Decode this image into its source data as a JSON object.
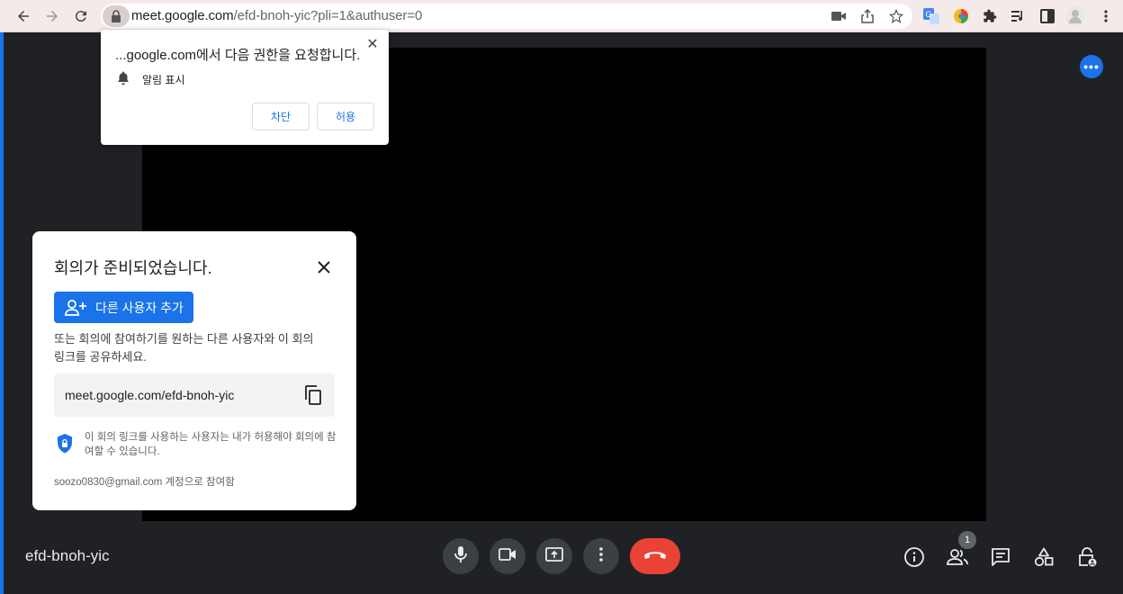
{
  "browser": {
    "url_host": "meet.google.com",
    "url_path": "/efd-bnoh-yic?pli=1&authuser=0"
  },
  "permission_popup": {
    "title": "...google.com에서 다음 권한을 요청합니다.",
    "item": "알림 표시",
    "block_label": "차단",
    "allow_label": "허용",
    "close": "✕"
  },
  "ready_card": {
    "title": "회의가 준비되었습니다.",
    "add_button": "다른 사용자 추가",
    "description": "또는 회의에 참여하기를 원하는 다른 사용자와 이 회의 링크를 공유하세요.",
    "meeting_link": "meet.google.com/efd-bnoh-yic",
    "secure_note": "이 회의 링크를 사용하는 사용자는 내가 허용해야 회의에 참여할 수 있습니다.",
    "account_note": "soozo0830@gmail.com 계정으로 참여함"
  },
  "bottom_bar": {
    "meeting_code": "efd-bnoh-yic",
    "participants_count": "1"
  },
  "colors": {
    "accent": "#1a73e8",
    "end_call": "#ea4335",
    "background": "#202124"
  }
}
